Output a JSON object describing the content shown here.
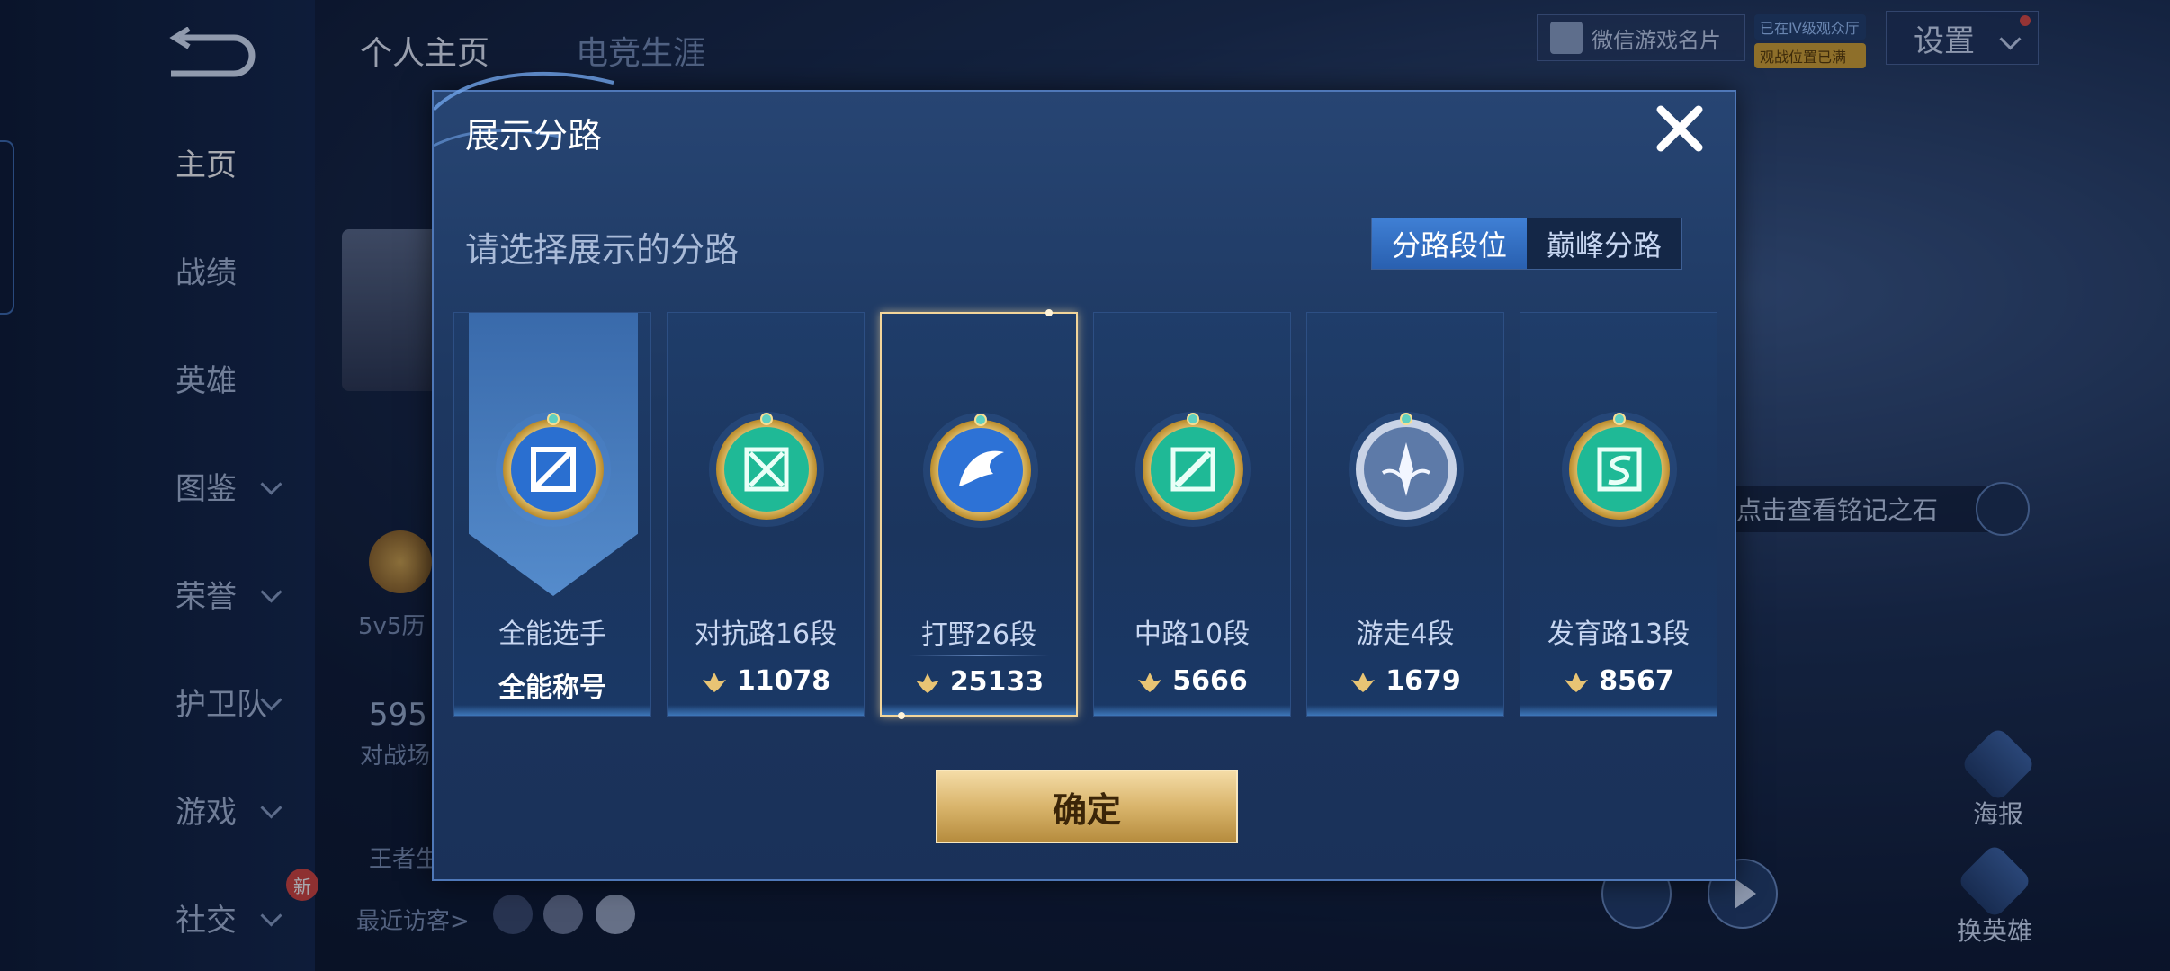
{
  "background": {
    "nav_items": [
      {
        "label": "主页",
        "has_chevron": false,
        "active": true
      },
      {
        "label": "战绩",
        "has_chevron": false,
        "active": false
      },
      {
        "label": "英雄",
        "has_chevron": false,
        "active": false
      },
      {
        "label": "图鉴",
        "has_chevron": true,
        "active": false
      },
      {
        "label": "荣誉",
        "has_chevron": true,
        "active": false
      },
      {
        "label": "护卫队",
        "has_chevron": true,
        "active": false
      },
      {
        "label": "游戏",
        "has_chevron": true,
        "active": false
      },
      {
        "label": "社交",
        "has_chevron": true,
        "active": false
      }
    ],
    "new_badge": "新",
    "tabs": [
      "个人主页",
      "电竞生涯"
    ],
    "wechat_card": "微信游戏名片",
    "qq_badge_1": "已在Ⅳ级观众厅",
    "qq_badge_2": "观战位置已满",
    "settings_label": "设置",
    "mode_label": "5v5历",
    "battle_count": "595",
    "battle_label": "对战场",
    "king_label": "王者生",
    "visitors_label": "最近访客>",
    "inscription_tip": "点击查看铭记之石",
    "poster_label": "海报",
    "switch_hero_label": "换英雄"
  },
  "modal": {
    "title": "展示分路",
    "subtitle": "请选择展示的分路",
    "toggle": [
      {
        "label": "分路段位",
        "active": true
      },
      {
        "label": "巅峰分路",
        "active": false
      }
    ],
    "cards": [
      {
        "name": "全能选手",
        "score": "全能称号",
        "has_leaf": false,
        "selected": false,
        "icon": "all-round-emblem-icon",
        "banner": true
      },
      {
        "name": "对抗路16段",
        "score": "11078",
        "has_leaf": true,
        "selected": false,
        "icon": "clash-lane-emblem-icon",
        "banner": false
      },
      {
        "name": "打野26段",
        "score": "25133",
        "has_leaf": true,
        "selected": true,
        "icon": "jungle-emblem-icon",
        "banner": false
      },
      {
        "name": "中路10段",
        "score": "5666",
        "has_leaf": true,
        "selected": false,
        "icon": "mid-lane-emblem-icon",
        "banner": false
      },
      {
        "name": "游走4段",
        "score": "1679",
        "has_leaf": true,
        "selected": false,
        "icon": "roam-emblem-icon",
        "banner": false
      },
      {
        "name": "发育路13段",
        "score": "8567",
        "has_leaf": true,
        "selected": false,
        "icon": "farm-lane-emblem-icon",
        "banner": false
      }
    ],
    "confirm_label": "确定"
  },
  "colors": {
    "accent": "#3f7fd4",
    "gold": "#d9b56c",
    "selected_border": "#f2d59a"
  }
}
